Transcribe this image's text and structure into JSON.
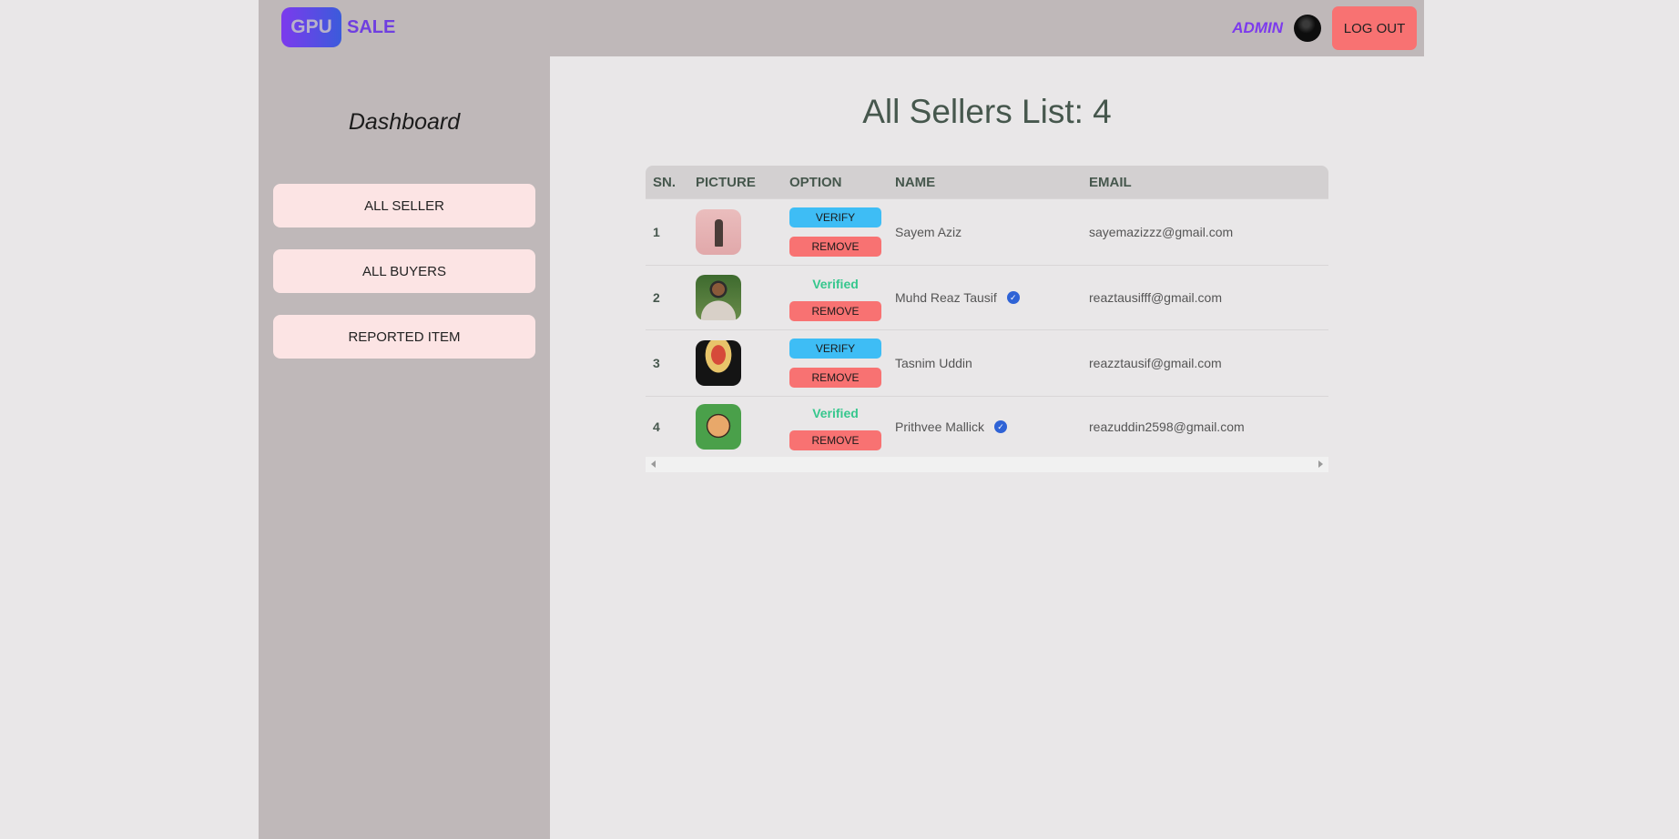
{
  "logo": {
    "badge": "GPU",
    "text": "SALE"
  },
  "header": {
    "role_label": "ADMIN",
    "logout_label": "LOG OUT"
  },
  "sidebar": {
    "title": "Dashboard",
    "items": [
      {
        "label": "ALL SELLER"
      },
      {
        "label": "ALL BUYERS"
      },
      {
        "label": "REPORTED ITEM"
      }
    ]
  },
  "main": {
    "title": "All Sellers List: 4",
    "table": {
      "headers": [
        "SN.",
        "PICTURE",
        "OPTION",
        "NAME",
        "EMAIL"
      ],
      "rows": [
        {
          "sn": "1",
          "name": "Sayem Aziz",
          "email": "sayemazizzz@gmail.com",
          "verified": false,
          "verify_label": "VERIFY",
          "remove_label": "REMOVE"
        },
        {
          "sn": "2",
          "name": "Muhd Reaz Tausif",
          "email": "reaztausifff@gmail.com",
          "verified": true,
          "verified_label": "Verified",
          "remove_label": "REMOVE"
        },
        {
          "sn": "3",
          "name": "Tasnim Uddin",
          "email": "reazztausif@gmail.com",
          "verified": false,
          "verify_label": "VERIFY",
          "remove_label": "REMOVE"
        },
        {
          "sn": "4",
          "name": "Prithvee Mallick",
          "email": "reazuddin2598@gmail.com",
          "verified": true,
          "verified_label": "Verified",
          "remove_label": "REMOVE"
        }
      ]
    }
  },
  "icons": {
    "verified_badge": "check-circle-icon",
    "scroll_left": "scroll-left-arrow-icon",
    "scroll_right": "scroll-right-arrow-icon"
  },
  "colors": {
    "navbar_bg": "#bfb8b9",
    "logout_bg": "#f87272",
    "verify_bg": "#3ebdf5",
    "remove_bg": "#f87272",
    "verified_text": "#36c78d",
    "admin_text": "#7c3aed",
    "sidebar_button_bg": "#fce4e4"
  }
}
